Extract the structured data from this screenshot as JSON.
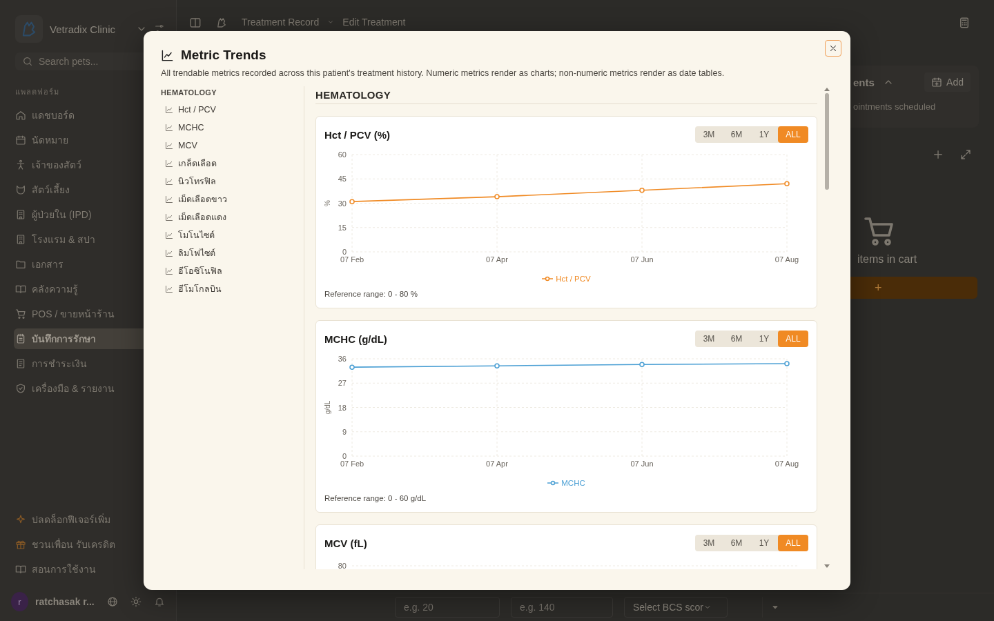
{
  "sidebar": {
    "clinic_name": "Vetradix Clinic",
    "search": {
      "placeholder": "Search pets..."
    },
    "section_label": "แพลตฟอร์ม",
    "items": [
      {
        "label": "แดชบอร์ด",
        "selected": false
      },
      {
        "label": "นัดหมาย",
        "selected": false
      },
      {
        "label": "เจ้าของสัตว์",
        "selected": false
      },
      {
        "label": "สัตว์เลี้ยง",
        "selected": false
      },
      {
        "label": "ผู้ป่วยใน (IPD)",
        "selected": false
      },
      {
        "label": "โรงแรม & สปา",
        "selected": false
      },
      {
        "label": "เอกสาร",
        "selected": false
      },
      {
        "label": "คลังความรู้",
        "selected": false
      },
      {
        "label": "POS / ขายหน้าร้าน",
        "selected": false
      },
      {
        "label": "บันทึกการรักษา",
        "selected": true
      },
      {
        "label": "การชำระเงิน",
        "selected": false
      },
      {
        "label": "เครื่องมือ & รายงาน",
        "selected": false
      }
    ],
    "extra_items": [
      {
        "label": "ปลดล็อกฟีเจอร์เพิ่ม",
        "kind": "promo"
      },
      {
        "label": "ชวนเพื่อน รับเครดิต",
        "kind": "promo"
      },
      {
        "label": "สอนการใช้งาน",
        "kind": "help"
      }
    ],
    "user": {
      "avatar_letter": "r",
      "name": "ratchasak r..."
    }
  },
  "breadcrumb": [
    "Treatment Record",
    "Edit Treatment"
  ],
  "right_panel": {
    "card_title": "ents",
    "add_button": "Add",
    "empty_text": "ointments scheduled",
    "cart_text": "items in cart",
    "cart_button": "+"
  },
  "form_fields": [
    {
      "placeholder": "e.g. 20"
    },
    {
      "placeholder": "e.g. 140"
    }
  ],
  "bcs_select": {
    "placeholder": "Select BCS scor"
  },
  "dialog": {
    "title": "Metric Trends",
    "description": "All trendable metrics recorded across this patient's treatment history. Numeric metrics render as charts; non-numeric metrics render as date tables.",
    "nav_group": "HEMATOLOGY",
    "nav_items": [
      "Hct / PCV",
      "MCHC",
      "MCV",
      "เกล็ดเลือด",
      "นิวโทรฟิล",
      "เม็ดเลือดขาว",
      "เม็ดเลือดแดง",
      "โมโนไซต์",
      "ลิมโฟไซต์",
      "อีโอซิโนฟิล",
      "ฮีโมโกลบิน"
    ],
    "section_title": "HEMATOLOGY",
    "charts": [
      {
        "title": "Hct / PCV (%)",
        "ranges": [
          {
            "label": "3M",
            "selected": false
          },
          {
            "label": "6M",
            "selected": false
          },
          {
            "label": "1Y",
            "selected": false
          },
          {
            "label": "ALL",
            "selected": true
          }
        ],
        "chart_data": {
          "type": "line",
          "ylabel": "%",
          "grid": true,
          "categories": [
            "07 Feb",
            "07 Apr",
            "07 Jun",
            "07 Aug"
          ],
          "ylim": [
            0,
            60
          ],
          "yticks": [
            0,
            15,
            30,
            45,
            60
          ],
          "series": [
            {
              "name": "Hct / PCV",
              "color": "#f08a24",
              "marker": "o",
              "values": [
                31,
                34,
                38,
                42
              ]
            }
          ]
        },
        "reference": "Reference range: 0 - 80 %"
      },
      {
        "title": "MCHC (g/dL)",
        "ranges": [
          {
            "label": "3M",
            "selected": false
          },
          {
            "label": "6M",
            "selected": false
          },
          {
            "label": "1Y",
            "selected": false
          },
          {
            "label": "ALL",
            "selected": true
          }
        ],
        "chart_data": {
          "type": "line",
          "ylabel": "g/dL",
          "grid": true,
          "categories": [
            "07 Feb",
            "07 Apr",
            "07 Jun",
            "07 Aug"
          ],
          "ylim": [
            0,
            36
          ],
          "yticks": [
            0,
            9,
            18,
            27,
            36
          ],
          "series": [
            {
              "name": "MCHC",
              "color": "#4a9fd4",
              "marker": "o",
              "values": [
                32.9,
                33.4,
                33.9,
                34.2
              ]
            }
          ]
        },
        "reference": "Reference range: 0 - 60 g/dL"
      },
      {
        "title": "MCV (fL)",
        "ranges": [
          {
            "label": "3M",
            "selected": false
          },
          {
            "label": "6M",
            "selected": false
          },
          {
            "label": "1Y",
            "selected": false
          },
          {
            "label": "ALL",
            "selected": true
          }
        ],
        "visible_y_tick": "80"
      }
    ]
  }
}
